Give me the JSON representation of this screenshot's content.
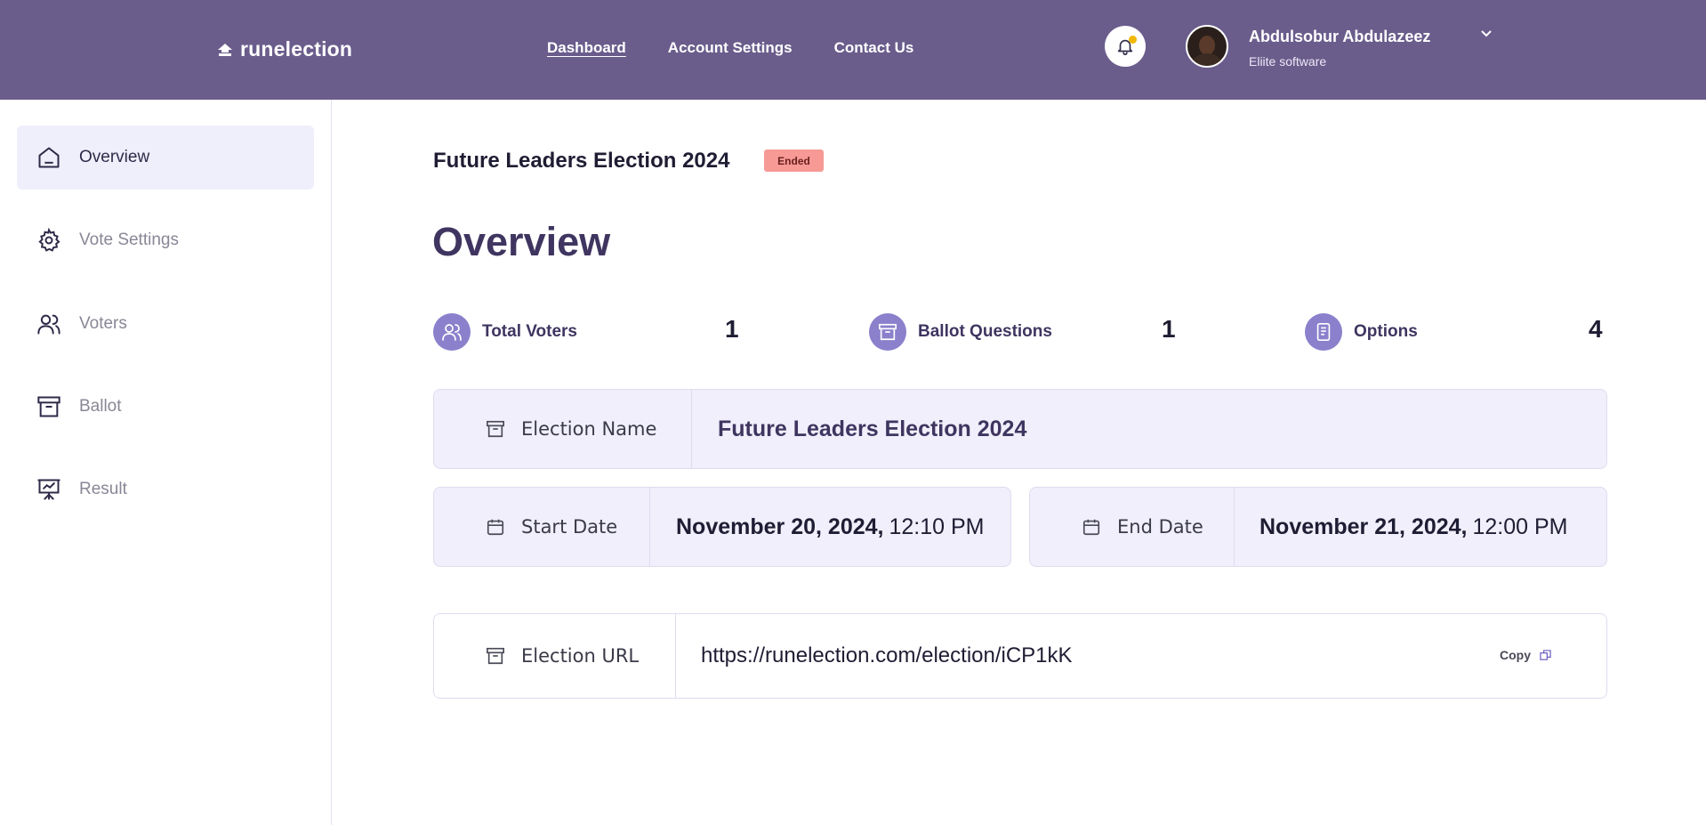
{
  "brand": {
    "name": "runelection"
  },
  "nav": [
    {
      "label": "Dashboard"
    },
    {
      "label": "Account Settings"
    },
    {
      "label": "Contact Us"
    }
  ],
  "user": {
    "name": "Abdulsobur Abdulazeez",
    "org": "Eliite software"
  },
  "sidebar": {
    "items": [
      {
        "label": "Overview",
        "icon": "home-icon",
        "active": true
      },
      {
        "label": "Vote Settings",
        "icon": "gear-icon"
      },
      {
        "label": "Voters",
        "icon": "users-icon"
      },
      {
        "label": "Ballot",
        "icon": "archive-icon"
      },
      {
        "label": "Result",
        "icon": "presentation-icon"
      }
    ]
  },
  "election": {
    "title": "Future Leaders Election 2024",
    "status": "Ended"
  },
  "page": {
    "title": "Overview"
  },
  "stats": [
    {
      "label": "Total Voters",
      "value": "1",
      "icon": "users-icon"
    },
    {
      "label": "Ballot Questions",
      "value": "1",
      "icon": "archive-icon"
    },
    {
      "label": "Options",
      "value": "4",
      "icon": "document-icon"
    }
  ],
  "details": {
    "name_label": "Election Name",
    "name_value": "Future Leaders Election 2024",
    "start_label": "Start Date",
    "start_date": "November 20, 2024,",
    "start_time": "12:10 PM",
    "end_label": "End Date",
    "end_date": "November 21, 2024,",
    "end_time": "12:00 PM",
    "url_label": "Election URL",
    "url_value": "https://runelection.com/election/iCP1kK",
    "copy_label": "Copy"
  },
  "colors": {
    "header": "#6a5d8c",
    "accent": "#8b80cc",
    "panel": "#f0effb",
    "badge": "#f79a96"
  }
}
